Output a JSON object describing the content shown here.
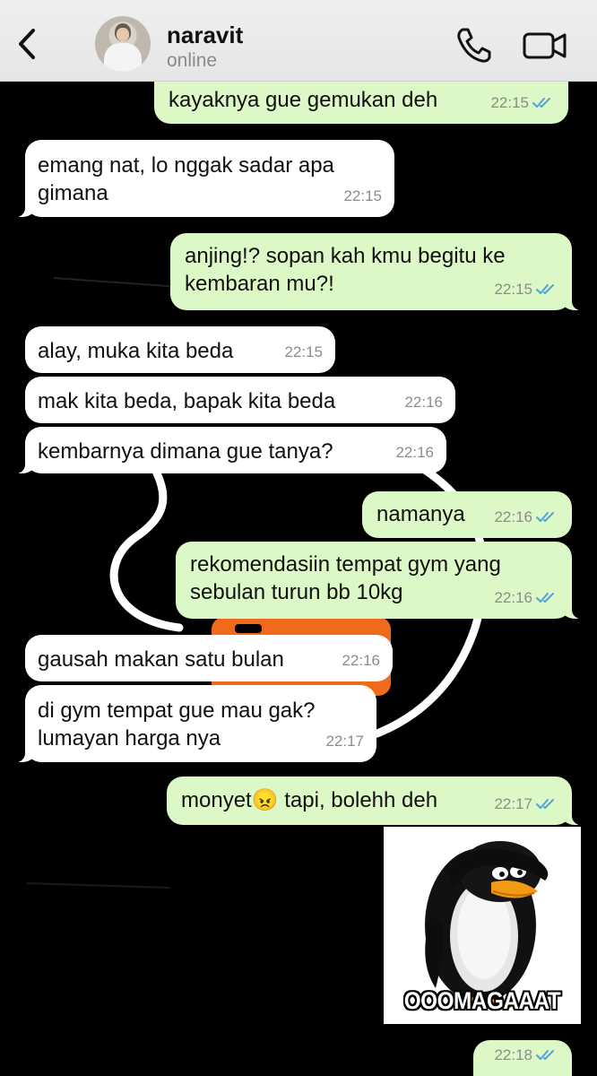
{
  "header": {
    "contact_name": "naravit",
    "status": "online",
    "icons": {
      "back": "chevron-left-icon",
      "call": "phone-icon",
      "video": "video-camera-icon"
    }
  },
  "colors": {
    "outgoing_bubble": "#dcf8c6",
    "incoming_bubble": "#ffffff",
    "chat_background": "#000000",
    "read_ticks": "#4fa3e0"
  },
  "messages": [
    {
      "dir": "out",
      "text": "kayaknya gue gemukan deh",
      "time": "22:15",
      "read": true
    },
    {
      "dir": "in",
      "text": "emang nat, lo nggak sadar apa\ngimana",
      "time": "22:15"
    },
    {
      "dir": "out",
      "text": "anjing!? sopan kah kmu begitu ke\nkembaran mu?!",
      "time": "22:15",
      "read": true
    },
    {
      "dir": "in",
      "text": "alay, muka kita beda",
      "time": "22:15"
    },
    {
      "dir": "in",
      "text": "mak kita beda, bapak kita beda",
      "time": "22:16"
    },
    {
      "dir": "in",
      "text": "kembarnya dimana gue tanya?",
      "time": "22:16"
    },
    {
      "dir": "out",
      "text": "namanya",
      "time": "22:16",
      "read": true
    },
    {
      "dir": "out",
      "text": "rekomendasiin tempat gym yang\nsebulan turun bb 10kg",
      "time": "22:16",
      "read": true
    },
    {
      "dir": "in",
      "text": "gausah makan satu bulan",
      "time": "22:16"
    },
    {
      "dir": "in",
      "text": "di gym tempat gue mau gak?\nlumayan harga nya",
      "time": "22:17"
    },
    {
      "dir": "out",
      "text": "monyet😠 tapi, bolehh deh",
      "time": "22:17",
      "read": true
    },
    {
      "dir": "out",
      "type": "sticker",
      "caption": "OOOMAGAAAT",
      "time": "22:18",
      "read": true
    }
  ]
}
